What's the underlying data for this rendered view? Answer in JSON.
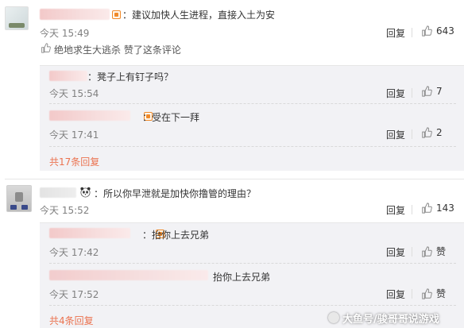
{
  "comments": [
    {
      "text": "：建议加快人生进程，直接入土为安",
      "time": "今天 15:49",
      "reply": "回复",
      "likes": "643",
      "liked_by_text": "绝地求生大逃杀 赞了这条评论",
      "replies": [
        {
          "text": "：凳子上有钉子吗？",
          "time": "今天 15:54",
          "reply": "回复",
          "likes": "7"
        },
        {
          "text": "：受在下一拜",
          "time": "今天 17:41",
          "reply": "回复",
          "likes": "2"
        }
      ],
      "more_replies": "共17条回复"
    },
    {
      "text": "：所以你早泄就是加快你撸管的理由？",
      "time": "今天 15:52",
      "reply": "回复",
      "likes": "143",
      "replies": [
        {
          "text": "：抬你上去兄弟",
          "time": "今天 17:42",
          "reply": "回复",
          "likes": "赞"
        },
        {
          "text": "抬你上去兄弟",
          "time": "今天 17:52",
          "reply": "回复",
          "likes": "赞"
        }
      ],
      "more_replies": "共4条回复"
    }
  ],
  "watermark": "大鱼号/骏哥哥说游戏",
  "colors": {
    "accent": "#eb7350",
    "time": "#808080",
    "subbox_bg": "#f2f2f5",
    "vip": "#f08a2a"
  },
  "icons": {
    "like": "thumbs-up-icon",
    "vip": "vip-badge-icon",
    "liked_by": "thumbs-up-outline-icon",
    "panda": "panda-emoji-icon"
  }
}
